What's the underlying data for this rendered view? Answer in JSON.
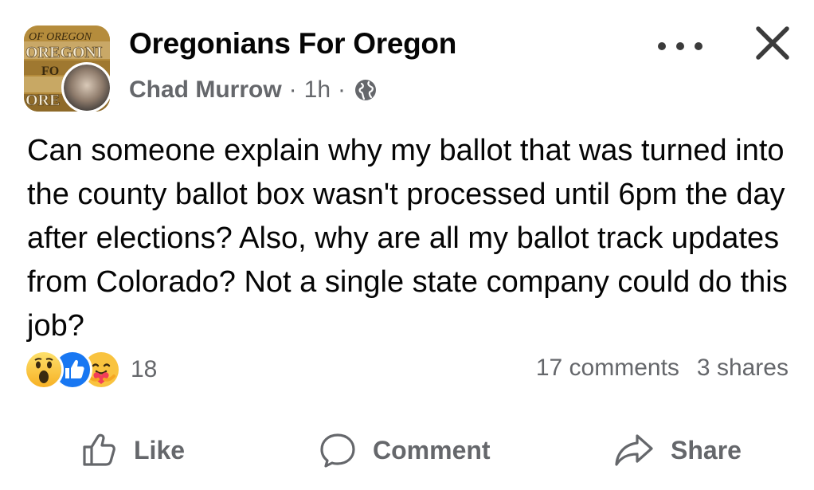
{
  "header": {
    "group_name": "Oregonians For Oregon",
    "author": "Chad Murrow",
    "separator": "·",
    "timestamp": "1h",
    "privacy_icon": "globe-icon",
    "group_avatar_text": [
      "OF OREGON",
      "OREGONI",
      "FO",
      "ORE"
    ]
  },
  "post": {
    "text": "Can someone explain why my ballot that was turned into the county ballot box wasn't processed until 6pm the day after elections? Also, why are all my ballot track updates from Colorado? Not a single state company could do this job?"
  },
  "reactions": {
    "icons": [
      "wow-icon",
      "like-icon",
      "care-icon"
    ],
    "count": "18",
    "comments": "17 comments",
    "shares": "3 shares"
  },
  "actions": {
    "like_label": "Like",
    "comment_label": "Comment",
    "share_label": "Share"
  },
  "colors": {
    "text": "#050505",
    "secondary": "#65676b",
    "like_blue": "#1877f2",
    "wow_yellow": "#f7b125",
    "care_red": "#f33e58"
  }
}
